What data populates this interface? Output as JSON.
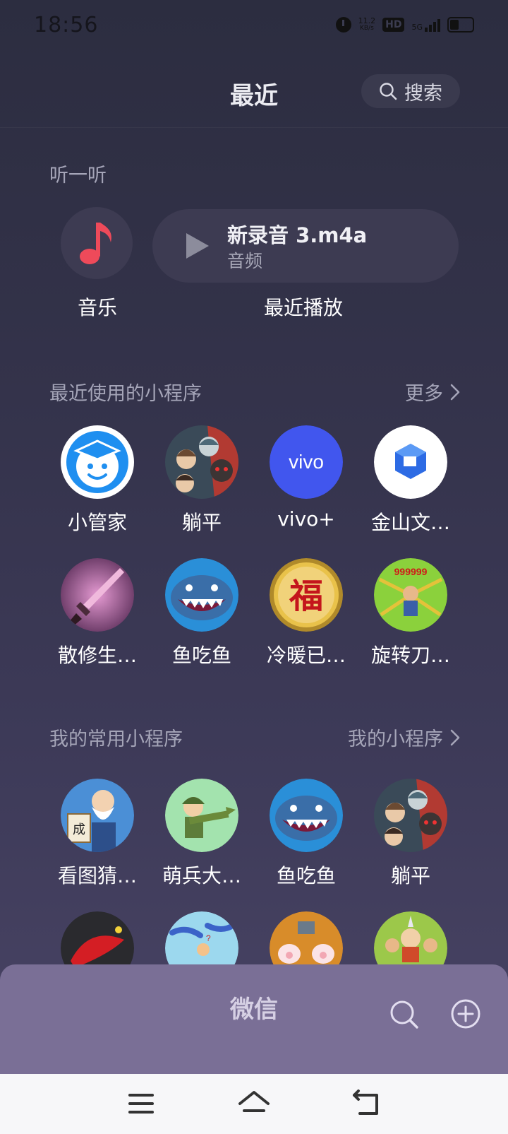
{
  "status": {
    "time": "18:56",
    "net_speed_top": "11.2",
    "net_speed_unit": "KB/s",
    "hd": "HD",
    "network": "5G"
  },
  "header": {
    "title": "最近",
    "search_label": "搜索"
  },
  "listen": {
    "section_title": "听一听",
    "music_label": "音乐",
    "recent_title": "新录音 3.m4a",
    "recent_subtitle": "音频",
    "recent_label": "最近播放"
  },
  "recent_apps": {
    "section_title": "最近使用的小程序",
    "more_label": "更多",
    "items": [
      {
        "label": "小管家",
        "icon": "robot-face-icon"
      },
      {
        "label": "躺平",
        "icon": "cartoon-family-icon"
      },
      {
        "label": "vivo+",
        "icon": "vivo-logo-icon"
      },
      {
        "label": "金山文…",
        "icon": "kingsoft-docs-icon"
      },
      {
        "label": "散修生…",
        "icon": "sword-icon"
      },
      {
        "label": "鱼吃鱼",
        "icon": "shark-icon"
      },
      {
        "label": "冷暖已…",
        "icon": "fu-coin-icon"
      },
      {
        "label": "旋转刀…",
        "icon": "spinning-blade-game-icon"
      }
    ]
  },
  "my_apps": {
    "section_title": "我的常用小程序",
    "more_label": "我的小程序",
    "items": [
      {
        "label": "看图猜…",
        "icon": "old-man-idiom-icon"
      },
      {
        "label": "萌兵大…",
        "icon": "soldier-icon"
      },
      {
        "label": "鱼吃鱼",
        "icon": "shark-icon"
      },
      {
        "label": "躺平",
        "icon": "cartoon-family-icon"
      }
    ],
    "partial_items": [
      {
        "icon": "red-fish-icon"
      },
      {
        "icon": "lizards-icon"
      },
      {
        "icon": "cat-paws-icon"
      },
      {
        "icon": "heroes-game-icon"
      }
    ]
  },
  "bottom_sheet": {
    "title": "微信"
  },
  "nav": {
    "menu": "menu-icon",
    "home": "home-icon",
    "back": "back-icon"
  }
}
